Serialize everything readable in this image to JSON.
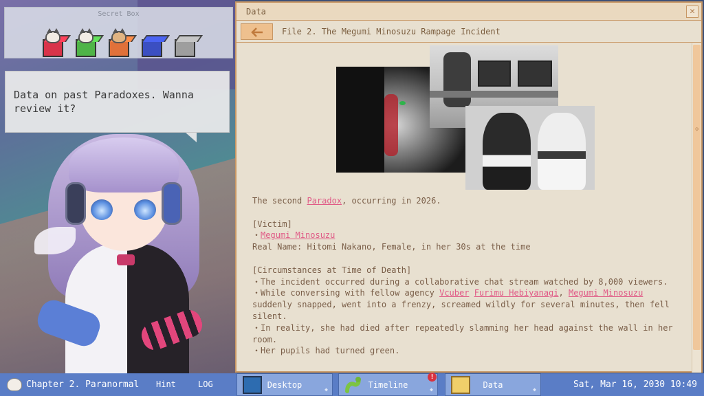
{
  "secret_box": {
    "title": "Secret Box",
    "items": [
      {
        "icon": "cat-in-red-box-icon",
        "color": "#d9344a"
      },
      {
        "icon": "cat-in-green-box-icon",
        "color": "#4fb448"
      },
      {
        "icon": "cat-in-orange-box-icon",
        "color": "#e0713a"
      },
      {
        "icon": "blue-box-icon",
        "color": "#3b4fc2"
      },
      {
        "icon": "gray-box-icon",
        "color": "#9e9e9e"
      }
    ]
  },
  "dialogue": {
    "text": "Data on past Paradoxes. Wanna review it?"
  },
  "data_window": {
    "title": "Data",
    "close_icon": "close-icon",
    "back_icon": "back-arrow-icon",
    "file_title": "File 2. The Megumi Minosuzu Rampage Incident",
    "scroll_marker": "◇"
  },
  "article": {
    "intro_prefix": "The second ",
    "intro_link": "Paradox",
    "intro_suffix": ", occurring in 2026.",
    "victim_header": "[Victim]",
    "victim_bullet": "・",
    "victim_name": "Megumi Minosuzu",
    "real_name": "Real Name: Hitomi Nakano, Female, in her 30s at the time",
    "circ_header": "[Circumstances at Time of Death]",
    "circ_1": "・The incident occurred during a collaborative chat stream watched by 8,000 viewers.",
    "circ_2_prefix": "・While conversing with fellow agency ",
    "circ_2_link_1": "Vcuber",
    "circ_2_link_2": "Furimu Hebiyanagi",
    "circ_2_sep": ", ",
    "circ_2_link_3": "Megumi Minosuzu",
    "circ_2_suffix": "suddenly snapped, went into a frenzy, screamed wildly for several minutes, then fell silent.",
    "circ_3": "・In reality, she had died after repeatedly slamming her head against the wall in her room.",
    "circ_4": "・Her pupils had turned green."
  },
  "taskbar": {
    "chapter": "Chapter 2. Paranormal",
    "hint": "Hint",
    "log": "LOG",
    "desktop": "Desktop",
    "timeline": "Timeline",
    "data": "Data",
    "alert": "!",
    "clock": "Sat, Mar 16, 2030 10:49"
  },
  "colors": {
    "accent_link": "#e05a86",
    "window_border": "#c89764",
    "taskbar": "#5a7dc6"
  }
}
